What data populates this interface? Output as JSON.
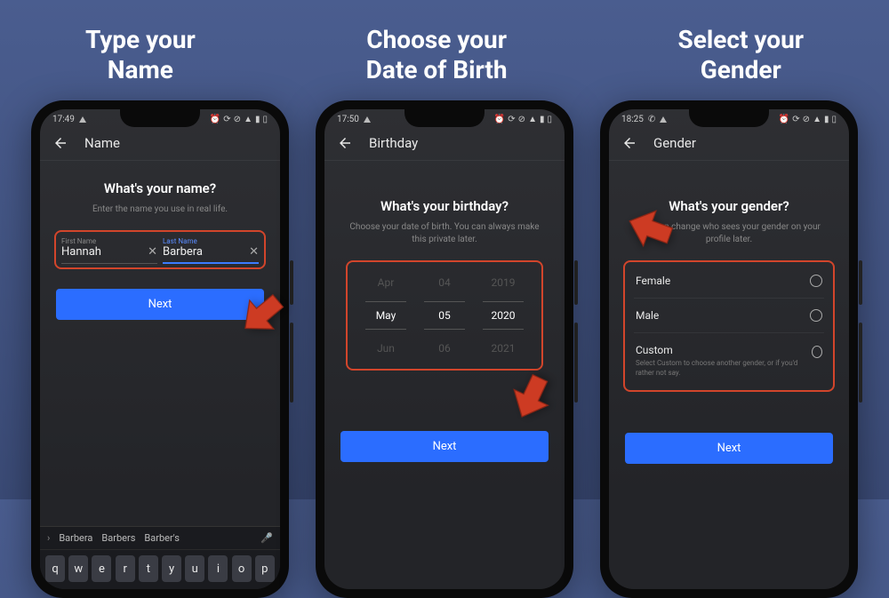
{
  "titles": [
    "Type your\nName",
    "Choose your\nDate of Birth",
    "Select your\nGender"
  ],
  "screen1": {
    "time": "17:49",
    "appbar": "Name",
    "heading": "What's your name?",
    "subtext": "Enter the name you use in real life.",
    "first_label": "First Name",
    "first_value": "Hannah",
    "last_label": "Last Name",
    "last_value": "Barbera",
    "next": "Next",
    "suggestions": [
      "Barbera",
      "Barbers",
      "Barber's"
    ],
    "keys": [
      "q",
      "w",
      "e",
      "r",
      "t",
      "y",
      "u",
      "i",
      "o",
      "p"
    ]
  },
  "screen2": {
    "time": "17:50",
    "appbar": "Birthday",
    "heading": "What's your birthday?",
    "subtext": "Choose your date of birth. You can always make this private later.",
    "months": [
      "Apr",
      "May",
      "Jun"
    ],
    "days": [
      "04",
      "05",
      "06"
    ],
    "years": [
      "2019",
      "2020",
      "2021"
    ],
    "next": "Next"
  },
  "screen3": {
    "time": "18:25",
    "appbar": "Gender",
    "heading": "What's your gender?",
    "subtext": "You can change who sees your gender on your profile later.",
    "opt1": "Female",
    "opt2": "Male",
    "opt3": "Custom",
    "opt3_note": "Select Custom to choose another gender, or if you'd rather not say.",
    "next": "Next"
  }
}
